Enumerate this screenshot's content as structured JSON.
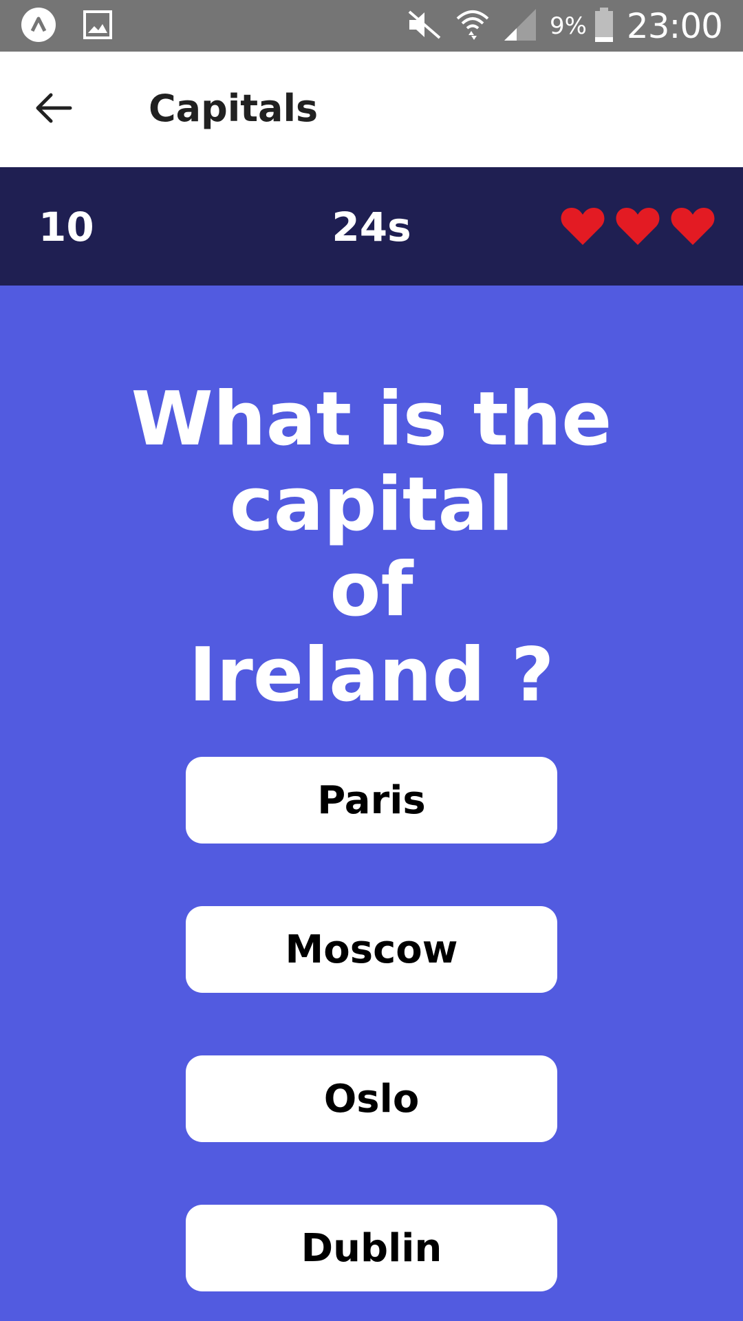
{
  "status_bar": {
    "icons": [
      "app-notification-icon",
      "image-icon",
      "muted-speaker-icon",
      "wifi-icon",
      "signal-icon",
      "battery-icon"
    ],
    "battery_percent": "9%",
    "time": "23:00"
  },
  "app_bar": {
    "back_icon": "arrow-left-icon",
    "title": "Capitals"
  },
  "info_bar": {
    "score": "10",
    "timer": "24s",
    "lives": 3,
    "lives_color": "#e31b23"
  },
  "question": {
    "line1": "What is the capital",
    "line2": "of",
    "line3": "Ireland ?"
  },
  "answers": [
    {
      "label": "Paris"
    },
    {
      "label": "Moscow"
    },
    {
      "label": "Oslo"
    },
    {
      "label": "Dublin"
    }
  ],
  "colors": {
    "background": "#525be0",
    "info_bar": "#1f1f52",
    "status_bar": "#757575",
    "app_bar": "#ffffff"
  }
}
